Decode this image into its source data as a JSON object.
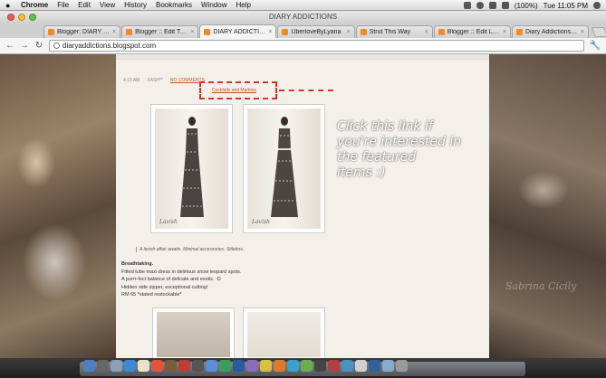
{
  "menubar": {
    "app_name": "Chrome",
    "items": [
      "File",
      "Edit",
      "View",
      "History",
      "Bookmarks",
      "Window",
      "Help"
    ],
    "battery": "(100%)",
    "clock": "Tue 11:05 PM"
  },
  "window": {
    "title": "DIARY ADDICTIONS"
  },
  "tabs": [
    {
      "label": "Blogger: DIARY ADDIC"
    },
    {
      "label": "Blogger :: Edit Templ"
    },
    {
      "label": "DIARY ADDICTIONS"
    },
    {
      "label": "UberloveByLyana"
    },
    {
      "label": "Strut This Way"
    },
    {
      "label": "Blogger :: Edit Layout"
    },
    {
      "label": "Diary Addictions: FAC"
    }
  ],
  "address_bar": {
    "url": "diaryaddictions.blogspot.com"
  },
  "post": {
    "meta_time": "4:10 AM",
    "meta_author": "XASH**",
    "meta_comments": "NO COMMENTS",
    "product_link": "Cocktails and Martinis",
    "caption": "A lavish affair awaits. Minimal accessories. Stilettos.",
    "desc_title": "Breathtaking.",
    "desc_lines": [
      "Fitted tube maxi dress in delirious snow leopard spots.",
      "A purrr-fect balance of delicate and exotic. :D",
      "Hidden side zipper, exceptional cutting!",
      "RM 65 *stated restockable*"
    ],
    "photo_sig": "Lavish"
  },
  "annotation": {
    "lines": [
      "Click this link if",
      "you're interested in",
      "the featured",
      "items :)"
    ]
  },
  "background": {
    "watermark": "Sabrina Cicily"
  },
  "colors": {
    "accent_red": "#d0352d",
    "link": "#c0502a",
    "content_bg": "#f3f0ea"
  }
}
